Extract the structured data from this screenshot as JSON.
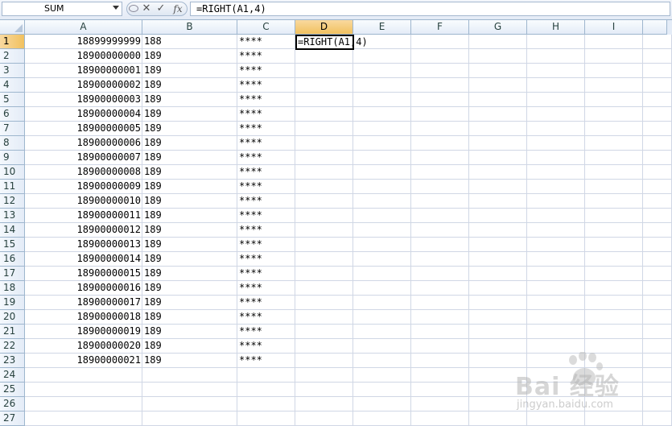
{
  "formula_bar": {
    "name_box": "SUM",
    "cancel_glyph": "✕",
    "enter_glyph": "✓",
    "fx_label": "fx",
    "formula": "=RIGHT(A1,4)"
  },
  "columns": [
    "A",
    "B",
    "C",
    "D",
    "E",
    "F",
    "G",
    "H",
    "I"
  ],
  "active_column": "D",
  "active_row": 1,
  "active_cell_text": "=RIGHT(A1,4)",
  "rows": [
    {
      "n": "1",
      "a": "18899999999",
      "b": "188",
      "c": "****"
    },
    {
      "n": "2",
      "a": "18900000000",
      "b": "189",
      "c": "****"
    },
    {
      "n": "3",
      "a": "18900000001",
      "b": "189",
      "c": "****"
    },
    {
      "n": "4",
      "a": "18900000002",
      "b": "189",
      "c": "****"
    },
    {
      "n": "5",
      "a": "18900000003",
      "b": "189",
      "c": "****"
    },
    {
      "n": "6",
      "a": "18900000004",
      "b": "189",
      "c": "****"
    },
    {
      "n": "7",
      "a": "18900000005",
      "b": "189",
      "c": "****"
    },
    {
      "n": "8",
      "a": "18900000006",
      "b": "189",
      "c": "****"
    },
    {
      "n": "9",
      "a": "18900000007",
      "b": "189",
      "c": "****"
    },
    {
      "n": "10",
      "a": "18900000008",
      "b": "189",
      "c": "****"
    },
    {
      "n": "11",
      "a": "18900000009",
      "b": "189",
      "c": "****"
    },
    {
      "n": "12",
      "a": "18900000010",
      "b": "189",
      "c": "****"
    },
    {
      "n": "13",
      "a": "18900000011",
      "b": "189",
      "c": "****"
    },
    {
      "n": "14",
      "a": "18900000012",
      "b": "189",
      "c": "****"
    },
    {
      "n": "15",
      "a": "18900000013",
      "b": "189",
      "c": "****"
    },
    {
      "n": "16",
      "a": "18900000014",
      "b": "189",
      "c": "****"
    },
    {
      "n": "17",
      "a": "18900000015",
      "b": "189",
      "c": "****"
    },
    {
      "n": "18",
      "a": "18900000016",
      "b": "189",
      "c": "****"
    },
    {
      "n": "19",
      "a": "18900000017",
      "b": "189",
      "c": "****"
    },
    {
      "n": "20",
      "a": "18900000018",
      "b": "189",
      "c": "****"
    },
    {
      "n": "21",
      "a": "18900000019",
      "b": "189",
      "c": "****"
    },
    {
      "n": "22",
      "a": "18900000020",
      "b": "189",
      "c": "****"
    },
    {
      "n": "23",
      "a": "18900000021",
      "b": "189",
      "c": "****"
    },
    {
      "n": "24",
      "a": "",
      "b": "",
      "c": ""
    },
    {
      "n": "25",
      "a": "",
      "b": "",
      "c": ""
    },
    {
      "n": "26",
      "a": "",
      "b": "",
      "c": ""
    },
    {
      "n": "27",
      "a": "",
      "b": "",
      "c": ""
    }
  ],
  "watermark": {
    "logo_text": "Bai  经验",
    "sub_text": "jingyan.baidu.com"
  },
  "colors": {
    "header_bg": "#e4ecf7",
    "active_header": "#f1c15f",
    "grid_line": "#d0d7e5"
  }
}
